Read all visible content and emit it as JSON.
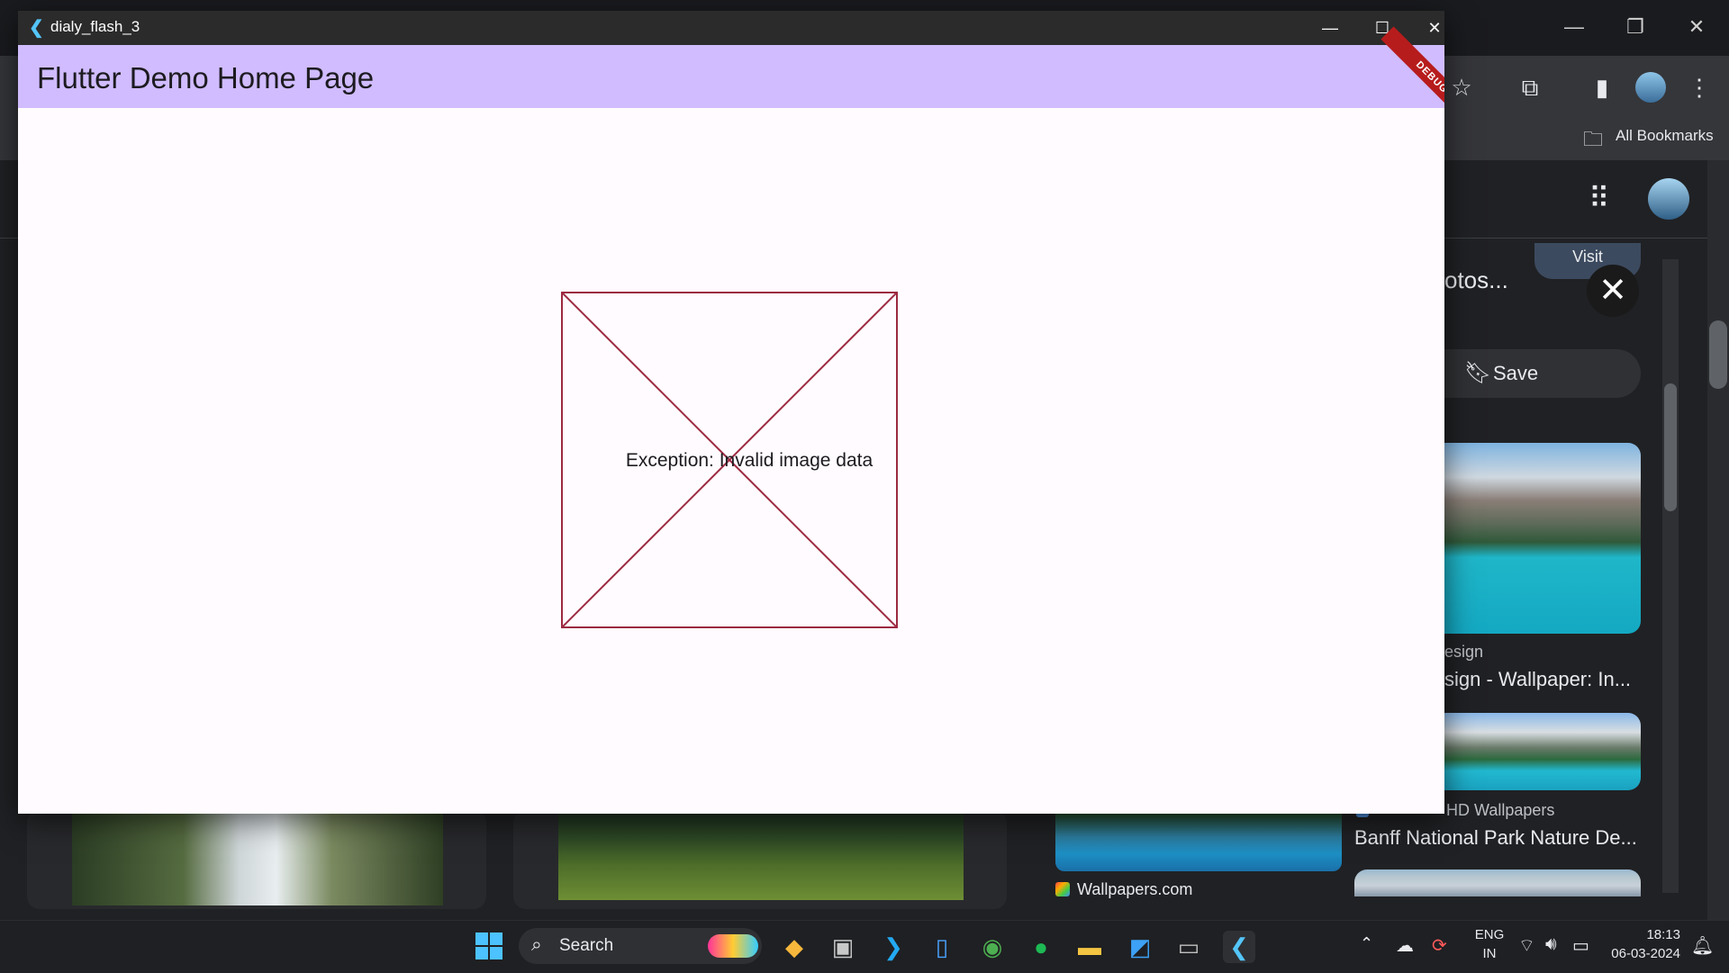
{
  "flutter_window": {
    "title": "dialy_flash_3",
    "minimize_glyph": "—",
    "maximize_glyph": "☐",
    "close_glyph": "✕",
    "appbar_title": "Flutter Demo Home Page",
    "debug_banner": "DEBUG",
    "error_message": "Exception: Invalid image data",
    "colors": {
      "appbar": "#d0bcff",
      "background": "#fffbfe",
      "error_border": "#9c2a40"
    }
  },
  "browser": {
    "bookmarks_label": "All Bookmarks",
    "side_panel": {
      "visit_label": "Visit",
      "heading_fragment": "otos...",
      "save_label": "Save",
      "result1_source": "esign",
      "result1_title": "sign - Wallpaper: In...",
      "result2_source": "HD Wallpapers",
      "result2_title": "Banff National Park Nature De...",
      "result3_source": "Wallpapers.com"
    }
  },
  "taskbar": {
    "search_label": "Search",
    "language_top": "ENG",
    "language_bottom": "IN",
    "time": "18:13",
    "date": "06-03-2024"
  }
}
